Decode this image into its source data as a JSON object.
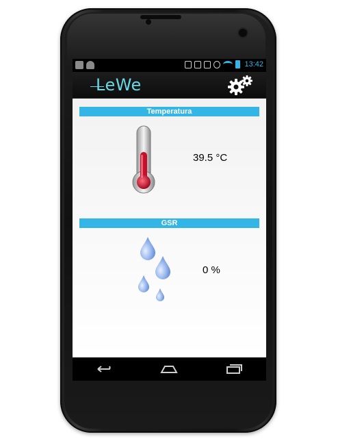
{
  "status_bar": {
    "time": "13:42"
  },
  "action_bar": {
    "app_name": "LeWe"
  },
  "sections": {
    "temperature": {
      "title": "Temperatura",
      "value": "39.5 °C"
    },
    "gsr": {
      "title": "GSR",
      "value": "0 %"
    }
  },
  "nav": {
    "back": "back-icon",
    "home": "home-icon",
    "recents": "recent-apps-icon"
  },
  "colors": {
    "accent": "#33b5e5",
    "logo": "#6ad7e4",
    "thermo_red": "#c4102a"
  }
}
